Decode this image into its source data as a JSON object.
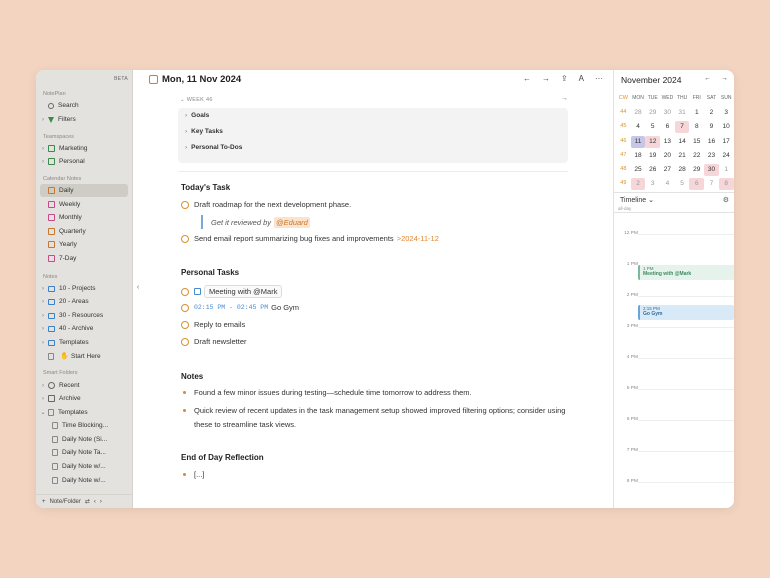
{
  "sidebar": {
    "beta": "BETA",
    "sections": {
      "noteplan": "NotePlan",
      "teamspaces": "Teamspaces",
      "calendar": "Calendar Notes",
      "notes": "Notes",
      "smart": "Smart Folders"
    },
    "top": {
      "search": "Search",
      "filters": "Filters"
    },
    "teamspaces": {
      "marketing": "Marketing",
      "personal": "Personal"
    },
    "calendar": {
      "daily": "Daily",
      "weekly": "Weekly",
      "monthly": "Monthly",
      "quarterly": "Quarterly",
      "yearly": "Yearly",
      "sevenday": "7-Day"
    },
    "notes": {
      "projects": "10 - Projects",
      "areas": "20 - Areas",
      "resources": "30 - Resources",
      "archive": "40 - Archive",
      "templates": "Templates",
      "start": "Start Here"
    },
    "smart": {
      "recent": "Recent",
      "archive": "Archive",
      "templates": "Templates"
    },
    "template_items": [
      "Time Blocking...",
      "Daily Note (Si...",
      "Daily Note Ta...",
      "Daily Note w/...",
      "Daily Note w/..."
    ],
    "new_note": "Note/Folder"
  },
  "editor": {
    "date_title": "Mon, 11 Nov 2024",
    "week_label": "WEEK 46",
    "week_rows": [
      "Goals",
      "Key Tasks",
      "Personal To-Dos"
    ],
    "todays_task": {
      "heading": "Today's Task",
      "t1": "Draft roadmap for the next development phase.",
      "sub": "Get it reviewed by",
      "sub_mention": "@Eduard",
      "t2": "Send email report summarizing bug fixes and improvements",
      "t2_date": ">2024-11-12"
    },
    "personal": {
      "heading": "Personal Tasks",
      "p1": "Meeting with @Mark",
      "p2_time": "02:15 PM - 02:45 PM",
      "p2": "Go Gym",
      "p3": "Reply to emails",
      "p4": "Draft newsletter"
    },
    "notes": {
      "heading": "Notes",
      "n1": "Found a few minor issues during testing—schedule time tomorrow to address them.",
      "n2": "Quick review of recent updates in the task management setup showed improved filtering options; consider using these to streamline task views."
    },
    "reflection": {
      "heading": "End of Day Reflection",
      "r1": "[...]"
    }
  },
  "calendar": {
    "month": "November 2024",
    "headers": [
      "CW",
      "MON",
      "TUE",
      "WED",
      "THU",
      "FRI",
      "SAT",
      "SUN"
    ],
    "weeks": [
      [
        "44",
        "28",
        "29",
        "30",
        "31",
        "1",
        "2",
        "3"
      ],
      [
        "45",
        "4",
        "5",
        "6",
        "7",
        "8",
        "9",
        "10"
      ],
      [
        "46",
        "11",
        "12",
        "13",
        "14",
        "15",
        "16",
        "17"
      ],
      [
        "47",
        "18",
        "19",
        "20",
        "21",
        "22",
        "23",
        "24"
      ],
      [
        "48",
        "25",
        "26",
        "27",
        "28",
        "29",
        "30",
        "1"
      ],
      [
        "49",
        "2",
        "3",
        "4",
        "5",
        "6",
        "7",
        "8"
      ]
    ]
  },
  "timeline": {
    "title": "Timeline",
    "allday": "all-day",
    "hours": [
      "12 PM",
      "1 PM",
      "2 PM",
      "3 PM",
      "4 PM",
      "5 PM",
      "6 PM",
      "7 PM",
      "8 PM"
    ],
    "ev1_time": "1 PM",
    "ev1_name": "Meeting with @Mark",
    "ev2_time": "2:15 PM",
    "ev2_name": "Go Gym"
  }
}
